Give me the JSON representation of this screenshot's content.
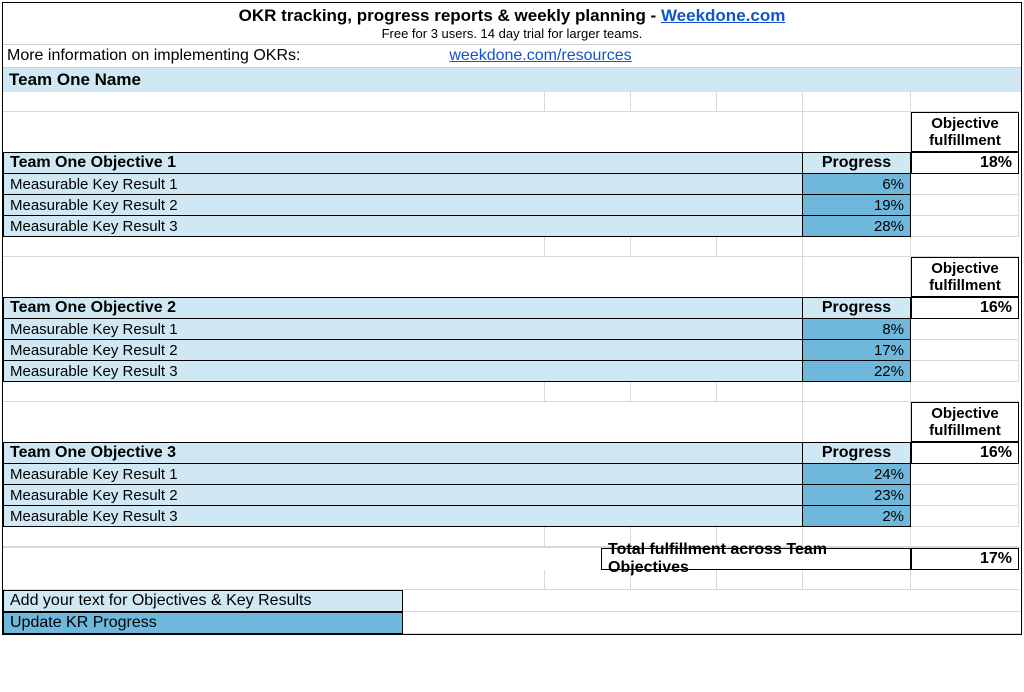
{
  "header": {
    "title_prefix": "OKR tracking, progress reports & weekly planning - ",
    "title_link": "Weekdone.com",
    "subtitle": "Free for 3 users. 14 day trial for larger teams."
  },
  "info": {
    "label": "More information on implementing OKRs:",
    "link": "weekdone.com/resources"
  },
  "team_name": "Team One Name",
  "labels": {
    "fulfillment_header": "Objective fulfillment",
    "progress": "Progress"
  },
  "objectives": [
    {
      "title": "Team One Objective 1",
      "fulfillment": "18%",
      "key_results": [
        {
          "label": "Measurable Key Result 1",
          "progress": "6%"
        },
        {
          "label": "Measurable Key Result 2",
          "progress": "19%"
        },
        {
          "label": "Measurable Key Result 3",
          "progress": "28%"
        }
      ]
    },
    {
      "title": "Team One Objective 2",
      "fulfillment": "16%",
      "key_results": [
        {
          "label": "Measurable Key Result 1",
          "progress": "8%"
        },
        {
          "label": "Measurable Key Result 2",
          "progress": "17%"
        },
        {
          "label": "Measurable Key Result 3",
          "progress": "22%"
        }
      ]
    },
    {
      "title": "Team One Objective 3",
      "fulfillment": "16%",
      "key_results": [
        {
          "label": "Measurable Key Result 1",
          "progress": "24%"
        },
        {
          "label": "Measurable Key Result 2",
          "progress": "23%"
        },
        {
          "label": "Measurable Key Result 3",
          "progress": "2%"
        }
      ]
    }
  ],
  "total": {
    "label": "Total fulfillment across Team Objectives",
    "value": "17%"
  },
  "instructions": {
    "line1": "Add your text for Objectives & Key Results",
    "line2": "Update KR Progress"
  }
}
